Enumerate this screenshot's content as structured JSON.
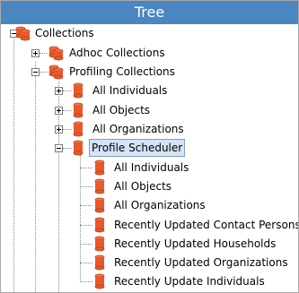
{
  "title": "Tree",
  "icon_color": "#e8592c",
  "selected_color": "#d4e4f7",
  "tree": {
    "root": "Collections",
    "adhoc": "Adhoc Collections",
    "profiling": "Profiling Collections",
    "profiling_children": [
      "All Individuals",
      "All Objects",
      "All Organizations"
    ],
    "scheduler": "Profile Scheduler",
    "scheduler_children": [
      "All Individuals",
      "All Objects",
      "All Organizations",
      "Recently Updated Contact Persons",
      "Recently Updated Households",
      "Recently Updated Organizations",
      "Recently Update Individuals"
    ]
  },
  "icons": {
    "collection": "database-stack-icon",
    "item": "database-cylinder-icon",
    "expand": "plus-icon",
    "collapse": "minus-icon"
  }
}
